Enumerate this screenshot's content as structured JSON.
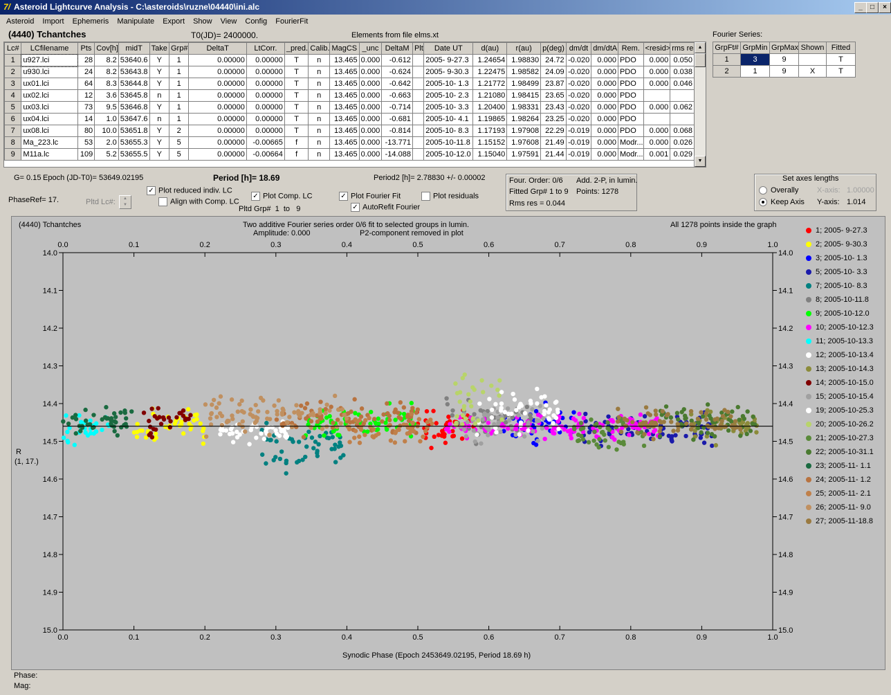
{
  "window": {
    "title": "Asteroid Lightcurve Analysis - C:\\asteroids\\ruzne\\04440\\ini.alc",
    "icon_glyph": "7/",
    "min_glyph": "_",
    "max_glyph": "□",
    "close_glyph": "×"
  },
  "menu": [
    "Asteroid",
    "Import",
    "Ephemeris",
    "Manipulate",
    "Export",
    "Show",
    "View",
    "Config",
    "FourierFit"
  ],
  "header": {
    "asteroid": "(4440) Tchantches",
    "t0": "T0(JD)= 2400000.",
    "elements": "Elements from file elms.xt"
  },
  "lc_table": {
    "columns": [
      "Lc#",
      "LCfilename",
      "Pts",
      "Cov[h]",
      "midT",
      "Take",
      "Grp#",
      "DeltaT",
      "LtCorr.",
      "_pred.",
      "Calib.",
      "MagCS",
      "_unc",
      "DeltaM",
      "Plt",
      "Date UT",
      "d(au)",
      "r(au)",
      "p(deg)",
      "dm/dt",
      "dm/dtA",
      "Rem.",
      "<resid>",
      "rms res"
    ],
    "rows": [
      [
        "1",
        "u927.lci",
        "28",
        "8.2",
        "53640.6",
        "Y",
        "1",
        "0.00000",
        "0.00000",
        "T",
        "n",
        "13.465",
        "0.000",
        "-0.612",
        "",
        "2005- 9-27.3",
        "1.24654",
        "1.98830",
        "24.72",
        "-0.020",
        "0.000",
        "PDO",
        "0.000",
        "0.050"
      ],
      [
        "2",
        "u930.lci",
        "24",
        "8.2",
        "53643.8",
        "Y",
        "1",
        "0.00000",
        "0.00000",
        "T",
        "n",
        "13.465",
        "0.000",
        "-0.624",
        "",
        "2005- 9-30.3",
        "1.22475",
        "1.98582",
        "24.09",
        "-0.020",
        "0.000",
        "PDO",
        "0.000",
        "0.038"
      ],
      [
        "3",
        "ux01.lci",
        "64",
        "8.3",
        "53644.8",
        "Y",
        "1",
        "0.00000",
        "0.00000",
        "T",
        "n",
        "13.465",
        "0.000",
        "-0.642",
        "",
        "2005-10- 1.3",
        "1.21772",
        "1.98499",
        "23.87",
        "-0.020",
        "0.000",
        "PDO",
        "0.000",
        "0.046"
      ],
      [
        "4",
        "ux02.lci",
        "12",
        "3.6",
        "53645.8",
        "n",
        "1",
        "0.00000",
        "0.00000",
        "T",
        "n",
        "13.465",
        "0.000",
        "-0.663",
        "",
        "2005-10- 2.3",
        "1.21080",
        "1.98415",
        "23.65",
        "-0.020",
        "0.000",
        "PDO",
        "",
        ""
      ],
      [
        "5",
        "ux03.lci",
        "73",
        "9.5",
        "53646.8",
        "Y",
        "1",
        "0.00000",
        "0.00000",
        "T",
        "n",
        "13.465",
        "0.000",
        "-0.714",
        "",
        "2005-10- 3.3",
        "1.20400",
        "1.98331",
        "23.43",
        "-0.020",
        "0.000",
        "PDO",
        "0.000",
        "0.062"
      ],
      [
        "6",
        "ux04.lci",
        "14",
        "1.0",
        "53647.6",
        "n",
        "1",
        "0.00000",
        "0.00000",
        "T",
        "n",
        "13.465",
        "0.000",
        "-0.681",
        "",
        "2005-10- 4.1",
        "1.19865",
        "1.98264",
        "23.25",
        "-0.020",
        "0.000",
        "PDO",
        "",
        ""
      ],
      [
        "7",
        "ux08.lci",
        "80",
        "10.0",
        "53651.8",
        "Y",
        "2",
        "0.00000",
        "0.00000",
        "T",
        "n",
        "13.465",
        "0.000",
        "-0.814",
        "",
        "2005-10- 8.3",
        "1.17193",
        "1.97908",
        "22.29",
        "-0.019",
        "0.000",
        "PDO",
        "0.000",
        "0.068"
      ],
      [
        "8",
        "Ma_223.lc",
        "53",
        "2.0",
        "53655.3",
        "Y",
        "5",
        "0.00000",
        "-0.00665",
        "f",
        "n",
        "13.465",
        "0.000",
        "-13.771",
        "",
        "2005-10-11.8",
        "1.15152",
        "1.97608",
        "21.49",
        "-0.019",
        "0.000",
        "Modr...",
        "0.000",
        "0.026"
      ],
      [
        "9",
        "M11a.lc",
        "109",
        "5.2",
        "53655.5",
        "Y",
        "5",
        "0.00000",
        "-0.00664",
        "f",
        "n",
        "13.465",
        "0.000",
        "-14.088",
        "",
        "2005-10-12.0",
        "1.15040",
        "1.97591",
        "21.44",
        "-0.019",
        "0.000",
        "Modr...",
        "0.001",
        "0.029"
      ]
    ]
  },
  "fourier_series": {
    "label": "Fourier Series:",
    "columns": [
      "GrpFt#",
      "GrpMin",
      "GrpMax",
      "Shown",
      "Fitted"
    ],
    "rows": [
      [
        "1",
        "3",
        "9",
        "",
        "T"
      ],
      [
        "2",
        "1",
        "9",
        "X",
        "T"
      ]
    ]
  },
  "info": {
    "g": "G= 0.15",
    "epoch": "Epoch (JD-T0)= 53649.02195",
    "period": "Period [h]= 18.69",
    "period2": "Period2 [h]= 2.78830 +/- 0.00002",
    "phaseref": "PhaseRef= 17.",
    "pltd_lc": "Pltd Lc#:",
    "pltd_grp": "Pltd Grp#",
    "grp_from": "1",
    "grp_to_label": "to",
    "grp_to": "9"
  },
  "options": {
    "plot_reduced": {
      "label": "Plot reduced indiv. LC",
      "checked": true
    },
    "align_comp": {
      "label": "Align with Comp. LC",
      "checked": false
    },
    "plot_comp": {
      "label": "Plot Comp. LC",
      "checked": true
    },
    "plot_fourier": {
      "label": "Plot Fourier Fit",
      "checked": true
    },
    "autorefit": {
      "label": "AutoRefit Fourier",
      "checked": true
    },
    "plot_residuals": {
      "label": "Plot residuals",
      "checked": false
    }
  },
  "fit_summary": {
    "four_order": "Four. Order:  0/6",
    "add": "Add. 2-P, in lumin.",
    "fitted_grp": "Fitted Grp# 1 to 9",
    "points": "Points: 1278",
    "rms": "Rms res     = 0.044"
  },
  "axes_box": {
    "title": "Set axes lengths",
    "overally": "Overally",
    "keep_axis": "Keep Axis",
    "xaxis_label": "X-axis:",
    "xaxis_value": "1.00000",
    "yaxis_label": "Y-axis:",
    "yaxis_value": "1.014",
    "selected": "keep_axis"
  },
  "plot": {
    "name": "(4440) Tchantches",
    "subtitle1": "Two additive Fourier series order 0/6 fit to selected groups in lumin.",
    "subtitle2": "Amplitude: 0.000",
    "subtitle3": "P2-component removed in plot",
    "inside": "All 1278 points inside the graph",
    "ylabel1": "R",
    "ylabel2": "(1, 17.)",
    "xlabel": "Synodic Phase (Epoch 2453649.02195, Period 18.69 h)"
  },
  "chart_data": {
    "type": "scatter",
    "xlim": [
      0.0,
      1.0
    ],
    "ylim": [
      14.0,
      15.0
    ],
    "y_inverted": true,
    "x_ticks": [
      "0.0",
      "0.1",
      "0.2",
      "0.3",
      "0.4",
      "0.5",
      "0.6",
      "0.7",
      "0.8",
      "0.9",
      "1.0"
    ],
    "y_ticks": [
      "14.0",
      "14.1",
      "14.2",
      "14.3",
      "14.4",
      "14.5",
      "14.6",
      "14.7",
      "14.8",
      "14.9",
      "15.0"
    ],
    "fit_line_mag": 14.46,
    "series": [
      {
        "name": "1; 2005- 9-27.3",
        "color": "#ff0000",
        "phase_range": [
          0.49,
          0.58
        ],
        "mean": 14.46,
        "spread": 0.05
      },
      {
        "name": "2; 2005- 9-30.3",
        "color": "#ffff00",
        "phase_range": [
          0.1,
          0.2
        ],
        "mean": 14.46,
        "spread": 0.04
      },
      {
        "name": "3; 2005-10- 1.3",
        "color": "#0000ff",
        "phase_range": [
          0.62,
          0.72
        ],
        "mean": 14.45,
        "spread": 0.05
      },
      {
        "name": "5; 2005-10- 3.3",
        "color": "#1a1aaa",
        "phase_range": [
          0.73,
          0.92
        ],
        "mean": 14.47,
        "spread": 0.04
      },
      {
        "name": "7; 2005-10- 8.3",
        "color": "#008080",
        "phase_range": [
          0.28,
          0.4
        ],
        "mean": 14.52,
        "spread": 0.06
      },
      {
        "name": "8; 2005-10-11.8",
        "color": "#808080",
        "phase_range": [
          0.54,
          0.66
        ],
        "mean": 14.44,
        "spread": 0.05
      },
      {
        "name": "9; 2005-10-12.0",
        "color": "#00ff00",
        "phase_range": [
          0.34,
          0.5
        ],
        "mean": 14.45,
        "spread": 0.04
      },
      {
        "name": "10; 2005-10-12.3",
        "color": "#ff00ff",
        "phase_range": [
          0.54,
          0.84
        ],
        "mean": 14.46,
        "spread": 0.03
      },
      {
        "name": "11; 2005-10-13.3",
        "color": "#00ffff",
        "phase_range": [
          0.0,
          0.07
        ],
        "mean": 14.46,
        "spread": 0.04
      },
      {
        "name": "12; 2005-10-13.4",
        "color": "#ffffff",
        "phase_range": [
          0.22,
          0.32
        ],
        "mean": 14.47,
        "spread": 0.03
      },
      {
        "name": "13; 2005-10-14.3",
        "color": "#8b8b3a",
        "phase_range": [
          0.88,
          0.98
        ],
        "mean": 14.46,
        "spread": 0.04
      },
      {
        "name": "14; 2005-10-15.0",
        "color": "#800000",
        "phase_range": [
          0.11,
          0.18
        ],
        "mean": 14.45,
        "spread": 0.04
      },
      {
        "name": "15; 2005-10-15.4",
        "color": "#a0a0a0",
        "phase_range": [
          0.56,
          0.68
        ],
        "mean": 14.45,
        "spread": 0.05
      },
      {
        "name": "19; 2005-10-25.3",
        "color": "#ffffff",
        "phase_range": [
          0.58,
          0.7
        ],
        "mean": 14.42,
        "spread": 0.05
      },
      {
        "name": "20; 2005-10-26.2",
        "color": "#b8d46a",
        "phase_range": [
          0.55,
          0.62
        ],
        "mean": 14.4,
        "spread": 0.08
      },
      {
        "name": "21; 2005-10-27.3",
        "color": "#5a8a3a",
        "phase_range": [
          0.72,
          0.82
        ],
        "mean": 14.48,
        "spread": 0.04
      },
      {
        "name": "22; 2005-10-31.1",
        "color": "#4a7a30",
        "phase_range": [
          0.84,
          0.98
        ],
        "mean": 14.45,
        "spread": 0.04
      },
      {
        "name": "23; 2005-11- 1.1",
        "color": "#1a6a40",
        "phase_range": [
          0.0,
          0.1
        ],
        "mean": 14.45,
        "spread": 0.04
      },
      {
        "name": "24; 2005-11- 1.2",
        "color": "#b87340",
        "phase_range": [
          0.3,
          0.5
        ],
        "mean": 14.44,
        "spread": 0.05
      },
      {
        "name": "25; 2005-11- 2.1",
        "color": "#c0804a",
        "phase_range": [
          0.4,
          0.52
        ],
        "mean": 14.47,
        "spread": 0.04
      },
      {
        "name": "26; 2005-11- 9.0",
        "color": "#c09060",
        "phase_range": [
          0.2,
          0.4
        ],
        "mean": 14.43,
        "spread": 0.05
      },
      {
        "name": "27; 2005-11-18.8",
        "color": "#9a7a40",
        "phase_range": [
          0.78,
          0.96
        ],
        "mean": 14.45,
        "spread": 0.03
      }
    ]
  },
  "status": {
    "phase": "Phase:",
    "mag": "Mag:"
  }
}
